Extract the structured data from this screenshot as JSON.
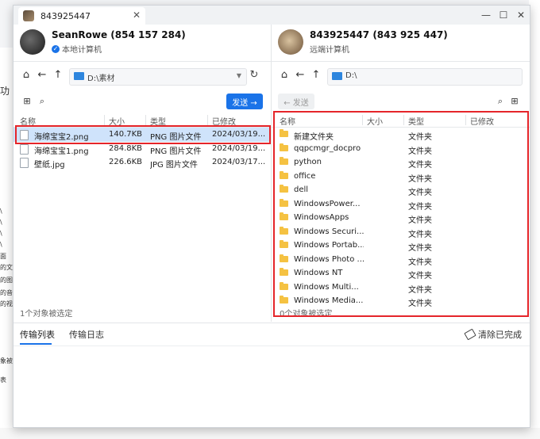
{
  "background": {
    "left_fragments": [
      "功",
      "\\",
      "\\",
      "\\",
      "\\",
      "面",
      "的文",
      "的图",
      "的音",
      "的视",
      "象被",
      "表"
    ]
  },
  "window": {
    "tab_title": "843925447",
    "controls": [
      "—",
      "☐",
      "✕"
    ]
  },
  "local": {
    "user_name": "SeanRowe (854 157 284)",
    "user_sub": "本地计算机",
    "path": "D:\\素材",
    "send_label": "发送 →",
    "columns": [
      "名称",
      "大小",
      "类型",
      "已修改"
    ],
    "files": [
      {
        "name": "海绵宝宝2.png",
        "size": "140.7KB",
        "type": "PNG 图片文件",
        "modified": "2024/03/19..."
      },
      {
        "name": "海绵宝宝1.png",
        "size": "284.8KB",
        "type": "PNG 图片文件",
        "modified": "2024/03/19..."
      },
      {
        "name": "壁纸.jpg",
        "size": "226.6KB",
        "type": "JPG 图片文件",
        "modified": "2024/03/17..."
      }
    ],
    "selected_index": 0,
    "status": "1个对象被选定"
  },
  "remote": {
    "user_name": "843925447 (843 925 447)",
    "user_sub": "远端计算机",
    "path": "D:\\",
    "send_label": "← 发送",
    "columns": [
      "名称",
      "大小",
      "类型",
      "已修改"
    ],
    "files": [
      {
        "name": "新建文件夹",
        "type": "文件夹"
      },
      {
        "name": "qqpcmgr_docpro",
        "type": "文件夹"
      },
      {
        "name": "python",
        "type": "文件夹"
      },
      {
        "name": "office",
        "type": "文件夹"
      },
      {
        "name": "dell",
        "type": "文件夹"
      },
      {
        "name": "WindowsPower...",
        "type": "文件夹"
      },
      {
        "name": "WindowsApps",
        "type": "文件夹"
      },
      {
        "name": "Windows Securi...",
        "type": "文件夹"
      },
      {
        "name": "Windows Portab...",
        "type": "文件夹"
      },
      {
        "name": "Windows Photo ...",
        "type": "文件夹"
      },
      {
        "name": "Windows NT",
        "type": "文件夹"
      },
      {
        "name": "Windows Multi...",
        "type": "文件夹"
      },
      {
        "name": "Windows Media...",
        "type": "文件夹"
      }
    ],
    "status": "0个对象被选定"
  },
  "transfer": {
    "tab_list": "传输列表",
    "tab_log": "传输日志",
    "clear_label": "清除已完成"
  },
  "colors": {
    "accent": "#1a73e8",
    "highlight": "#e5252a",
    "selection": "#cfe3fb"
  }
}
